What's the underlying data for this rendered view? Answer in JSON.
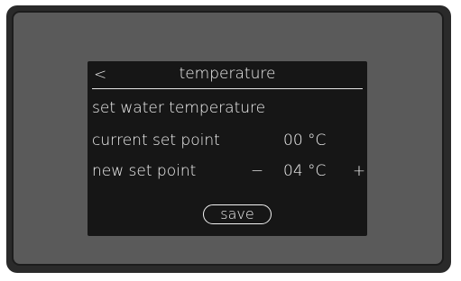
{
  "header": {
    "back_label": "<",
    "title": "temperature"
  },
  "main": {
    "section_title": "set water temperature",
    "current": {
      "label": "current set point",
      "value": "00 °C"
    },
    "new": {
      "label": "new set point",
      "decrement_label": "−",
      "value": "04 °C",
      "increment_label": "+"
    },
    "save_label": "save"
  },
  "colors": {
    "device_frame": "#2a2a2a",
    "device_panel": "#5a5a5a",
    "screen_background": "#161616",
    "text": "#f2f2f2"
  }
}
